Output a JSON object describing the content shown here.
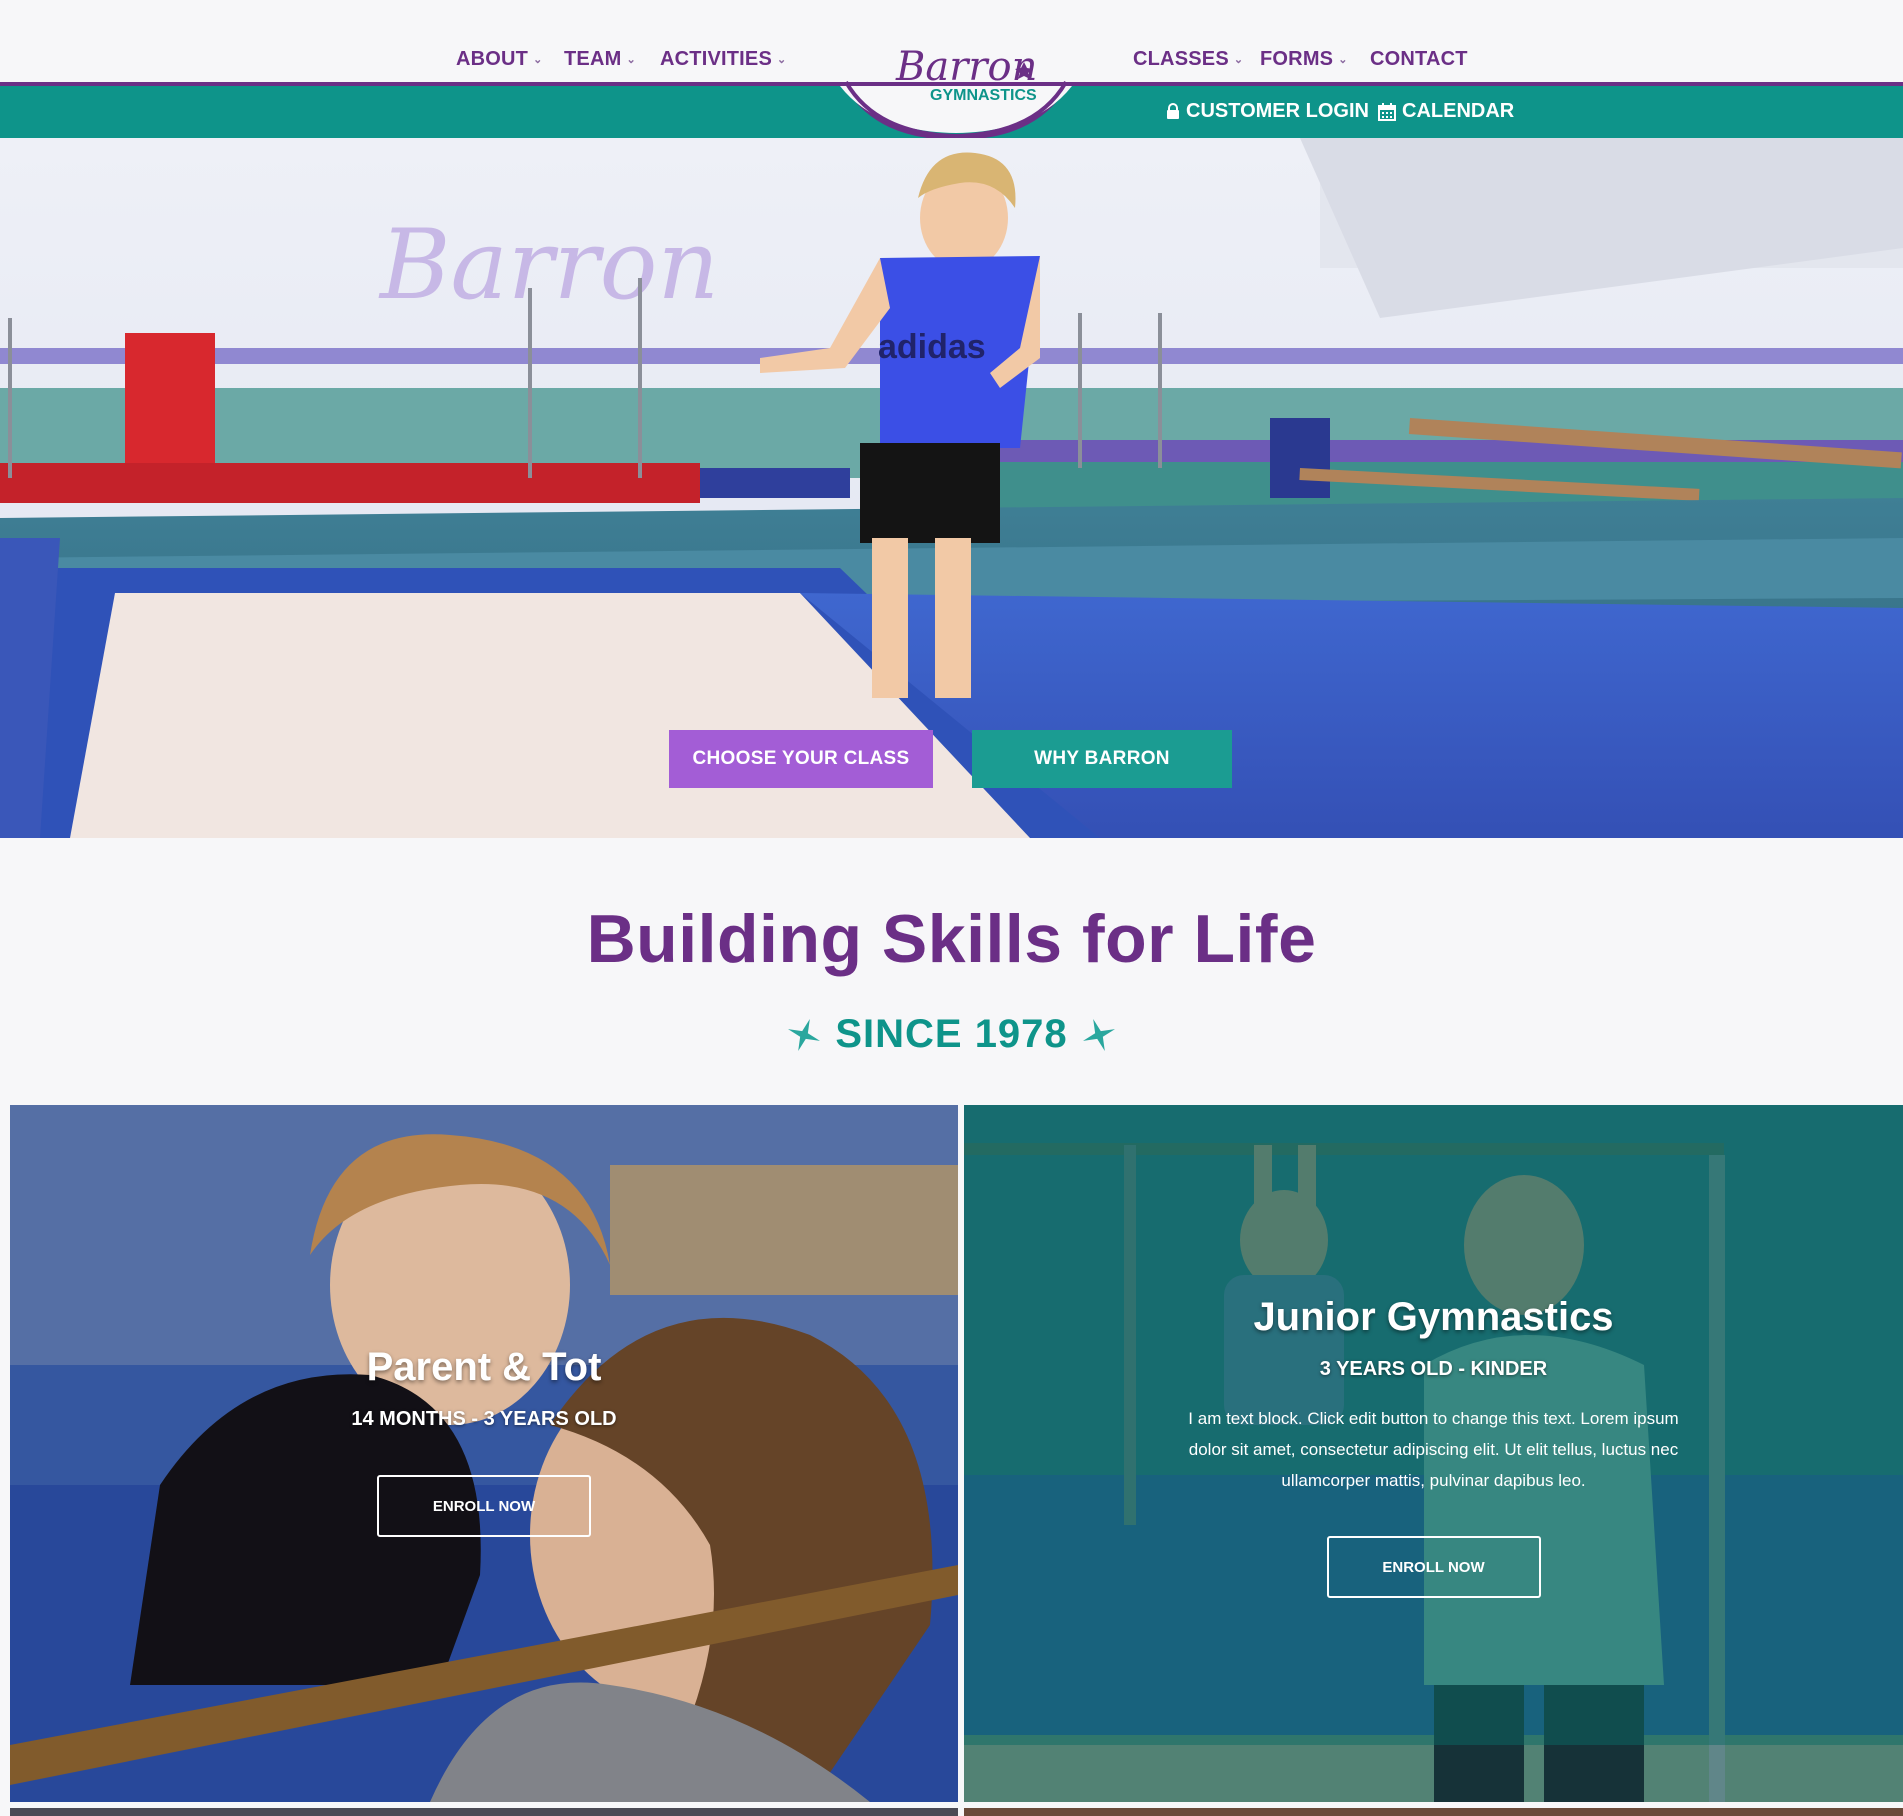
{
  "brand": {
    "logo_script": "Barron",
    "logo_sub": "GYMNASTICS",
    "purple": "#6b2f86",
    "teal": "#0e948a",
    "accent_purple": "#a35dd6"
  },
  "nav": {
    "left": [
      {
        "label": "ABOUT",
        "has_dropdown": true
      },
      {
        "label": "TEAM",
        "has_dropdown": true
      },
      {
        "label": "ACTIVITIES",
        "has_dropdown": true
      }
    ],
    "right": [
      {
        "label": "CLASSES",
        "has_dropdown": true
      },
      {
        "label": "FORMS",
        "has_dropdown": true
      },
      {
        "label": "CONTACT",
        "has_dropdown": false
      }
    ],
    "dropdown_glyph": "⌄"
  },
  "utility": {
    "login_label": "CUSTOMER LOGIN",
    "login_icon": "lock-icon",
    "calendar_label": "CALENDAR",
    "calendar_icon": "calendar-icon"
  },
  "hero": {
    "wall_logo": "Barron",
    "shirt_text": "adidas",
    "cta_primary": "CHOOSE YOUR CLASS",
    "cta_secondary": "WHY BARRON"
  },
  "tagline": {
    "headline": "Building Skills for Life",
    "since": "SINCE 1978",
    "star_icon": "sparkle-star-icon"
  },
  "classes": [
    {
      "title": "Parent & Tot",
      "age": "14 MONTHS - 3 YEARS OLD",
      "description": "",
      "button": "ENROLL NOW"
    },
    {
      "title": "Junior Gymnastics",
      "age": "3 YEARS OLD - KINDER",
      "description": "I am text block. Click edit button to change this text. Lorem ipsum dolor sit amet, consectetur adipiscing elit. Ut elit tellus, luctus nec ullamcorper mattis, pulvinar dapibus leo.",
      "button": "ENROLL NOW"
    }
  ]
}
